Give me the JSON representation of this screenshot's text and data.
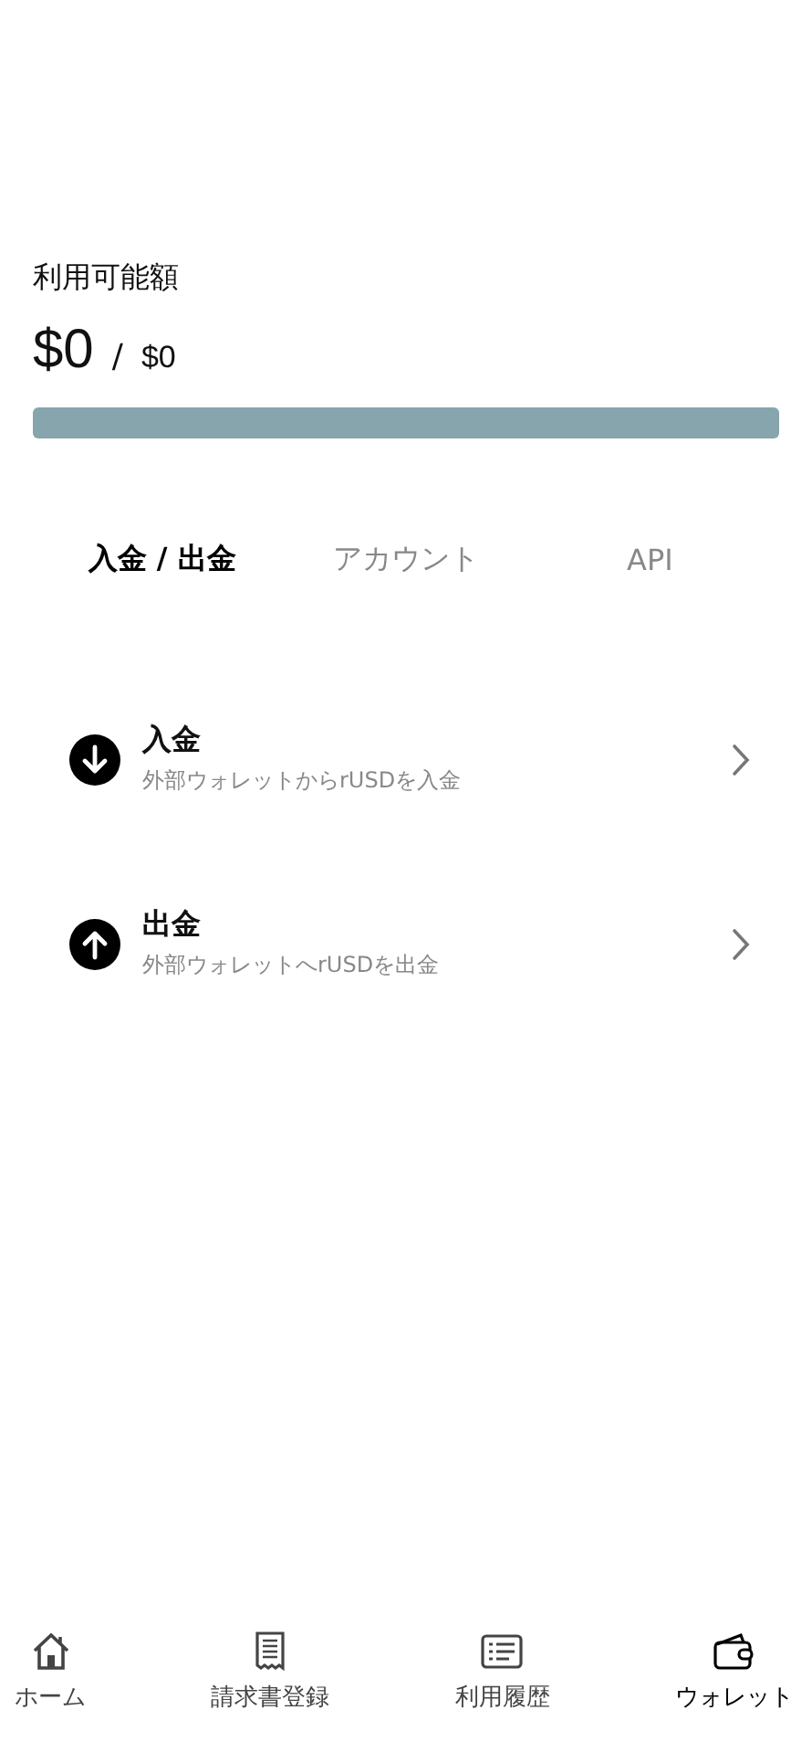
{
  "balance": {
    "label": "利用可能額",
    "amount": "$0",
    "separator": "/",
    "limit": "$0",
    "level": 0
  },
  "tabs": [
    {
      "label": "入金 / 出金",
      "selected": true
    },
    {
      "label": "アカウント",
      "selected": false
    },
    {
      "label": "API",
      "selected": false
    }
  ],
  "actions": [
    {
      "kind": "deposit",
      "title": "入金",
      "subtitle": "外部ウォレットからrUSDを入金"
    },
    {
      "kind": "withdraw",
      "title": "出金",
      "subtitle": "外部ウォレットへrUSDを出金"
    }
  ],
  "nav": [
    {
      "kind": "home",
      "label": "ホーム",
      "selected": false
    },
    {
      "kind": "invoice",
      "label": "請求書登録",
      "selected": false
    },
    {
      "kind": "history",
      "label": "利用履歴",
      "selected": false
    },
    {
      "kind": "wallet",
      "label": "ウォレット",
      "selected": true
    }
  ]
}
